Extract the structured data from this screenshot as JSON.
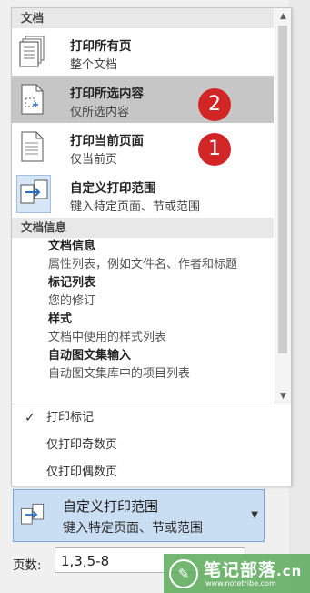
{
  "sections": {
    "documents_header": "文档",
    "document_info_header": "文档信息"
  },
  "print_items": [
    {
      "title": "打印所有页",
      "subtitle": "整个文档",
      "icon": "pages-stack-icon"
    },
    {
      "title": "打印所选内容",
      "subtitle": "仅所选内容",
      "icon": "page-selection-icon",
      "selected": true
    },
    {
      "title": "打印当前页面",
      "subtitle": "仅当前页",
      "icon": "single-page-icon"
    },
    {
      "title": "自定义打印范围",
      "subtitle": "键入特定页面、节或范围",
      "icon": "custom-range-icon"
    }
  ],
  "info_items": [
    {
      "title": "文档信息",
      "subtitle": "属性列表，例如文件名、作者和标题"
    },
    {
      "title": "标记列表",
      "subtitle": "您的修订"
    },
    {
      "title": "样式",
      "subtitle": "文档中使用的样式列表"
    },
    {
      "title": "自动图文集输入",
      "subtitle": "自动图文集库中的项目列表"
    }
  ],
  "options": [
    {
      "label": "打印标记",
      "checked": true
    },
    {
      "label": "仅打印奇数页",
      "checked": false
    },
    {
      "label": "仅打印偶数页",
      "checked": false
    }
  ],
  "badges": {
    "one": "1",
    "two": "2"
  },
  "selector": {
    "title": "自定义打印范围",
    "subtitle": "键入特定页面、节或范围"
  },
  "pages": {
    "label": "页数:",
    "value": "1,3,5-8"
  },
  "watermark": {
    "text": "笔记部落",
    "url": "www.notetribe.com",
    "suffix": ".cn"
  },
  "colors": {
    "selected": "#c6c6c6",
    "badge": "#d22525",
    "selector_bg": "#c9ddf3"
  }
}
